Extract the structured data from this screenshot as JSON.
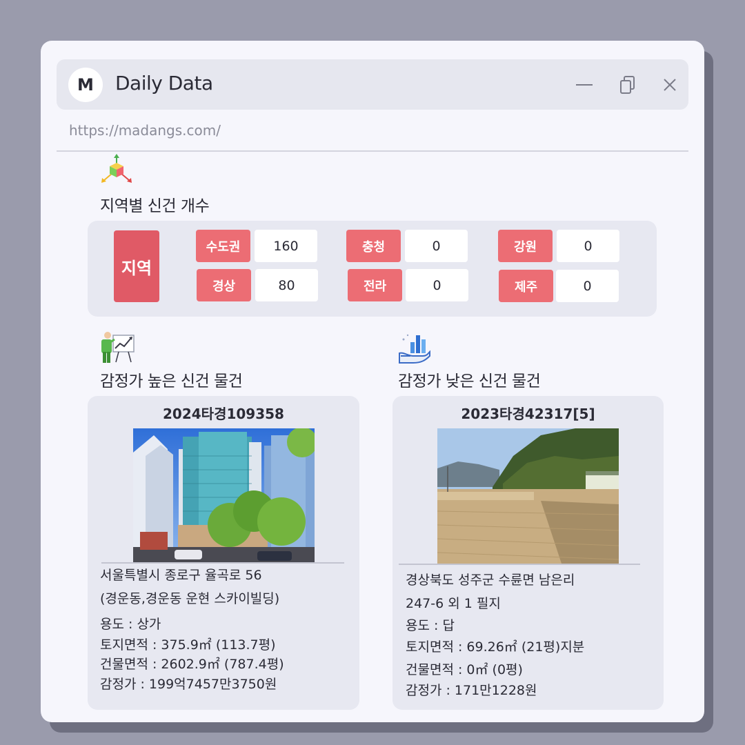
{
  "window": {
    "avatar_letter": "M",
    "app_title": "Daily Data",
    "url": "https://madangs.com/"
  },
  "region_section": {
    "icon": "3d-axes-cube-icon",
    "title": "지역별 신건 개수",
    "main_label": "지역",
    "regions": [
      {
        "label": "수도권",
        "count": "160"
      },
      {
        "label": "경상",
        "count": "80"
      },
      {
        "label": "충청",
        "count": "0"
      },
      {
        "label": "전라",
        "count": "0"
      },
      {
        "label": "강원",
        "count": "0"
      },
      {
        "label": "제주",
        "count": "0"
      }
    ]
  },
  "high_section": {
    "icon": "presentation-chart-icon",
    "title": "감정가 높은 신건 물건",
    "case_no": "2024타경109358",
    "address_line1": "서울특별시 종로구 율곡로 56",
    "address_line2": "(경운동,경운동 운현 스카이빌딩)",
    "usage": "용도 : 상가",
    "land_area": "토지면적 : 375.9㎡ (113.7평)",
    "building_area": "건물면적 : 2602.9㎡ (787.4평)",
    "appraisal": "감정가 : 199억7457만3750원"
  },
  "low_section": {
    "icon": "hand-bar-chart-icon",
    "title": "감정가 낮은 신건 물건",
    "case_no": "2023타경42317[5]",
    "address_line1": "경상북도 성주군 수륜면 남은리",
    "address_line2": "247-6 외 1 필지",
    "usage": "용도 : 답",
    "land_area": "토지면적 : 69.26㎡ (21평)지분",
    "building_area": "건물면적 : 0㎡ (0평)",
    "appraisal": "감정가 : 171만1228원"
  },
  "colors": {
    "background": "#9a9bac",
    "window": "#f6f6fc",
    "titlebar": "#e6e7ef",
    "panel": "#e7e8f1",
    "tag": "#ec6d74",
    "region_main": "#e05a66"
  }
}
